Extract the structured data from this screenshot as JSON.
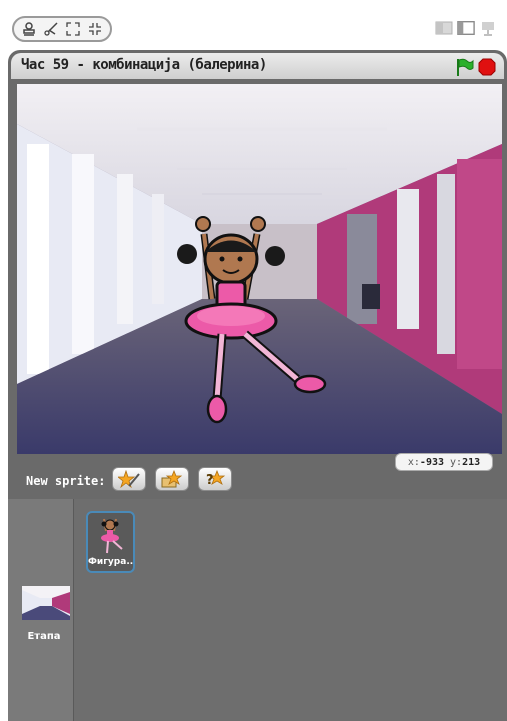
{
  "toolbar": {
    "tools": [
      "stamp-icon",
      "scissors-icon",
      "grow-icon",
      "shrink-icon"
    ],
    "layout": [
      "small-stage-icon",
      "normal-stage-icon",
      "presentation-icon"
    ]
  },
  "stage": {
    "title": "Час 59 - комбинација (балерина)",
    "green_flag_color": "#2bb02b",
    "stop_color": "#e01010"
  },
  "sprite_bar": {
    "new_sprite_label": "New sprite:",
    "buttons": [
      "paint-sprite-icon",
      "choose-sprite-icon",
      "random-sprite-icon"
    ],
    "x_label": "x:",
    "x_value": "-933",
    "y_label": "y:",
    "y_value": "213"
  },
  "sprite_list": {
    "stage_label": "Етапа",
    "sprites": [
      {
        "name": "Фигура..."
      }
    ]
  },
  "colors": {
    "panel": "#6a6a6a",
    "selected_border": "#4a8ab8",
    "dress_pink": "#ec5aa8"
  }
}
